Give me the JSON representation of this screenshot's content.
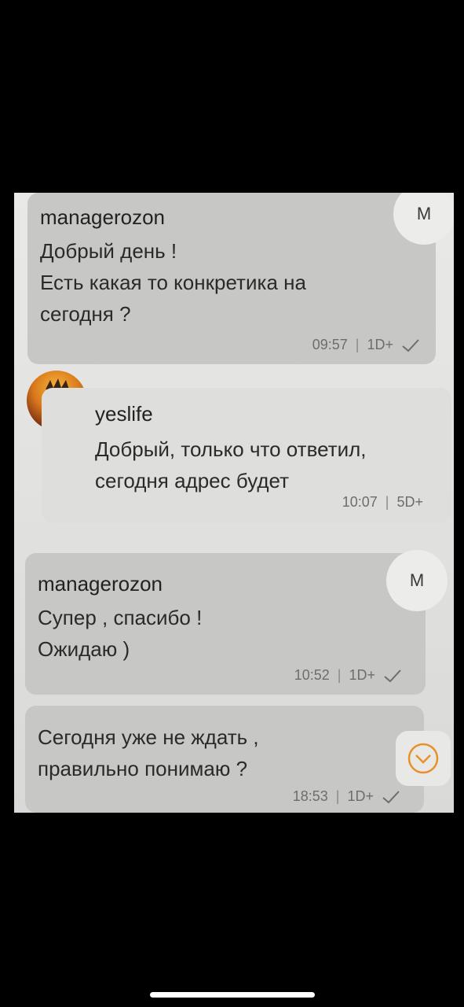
{
  "messages": [
    {
      "sender": "managerozon",
      "text": "Добрый день !\nЕсть какая то конкретика на\nсегодня ?",
      "time": "09:57",
      "status": "1D+",
      "avatar": "M"
    },
    {
      "sender": "yeslife",
      "text": "Добрый, только что ответил,\nсегодня адрес будет",
      "time": "10:07",
      "status": "5D+"
    },
    {
      "sender": "managerozon",
      "text": "Супер , спасибо !\nОжидаю )",
      "time": "10:52",
      "status": "1D+",
      "avatar": "M"
    },
    {
      "text": "Сегодня уже не ждать ,\nправильно понимаю ?",
      "time": "18:53",
      "status": "1D+"
    }
  ],
  "icons": {
    "read_check": "check-icon",
    "scroll_down": "chevron-down-icon"
  },
  "colors": {
    "accent": "#e8912a"
  }
}
